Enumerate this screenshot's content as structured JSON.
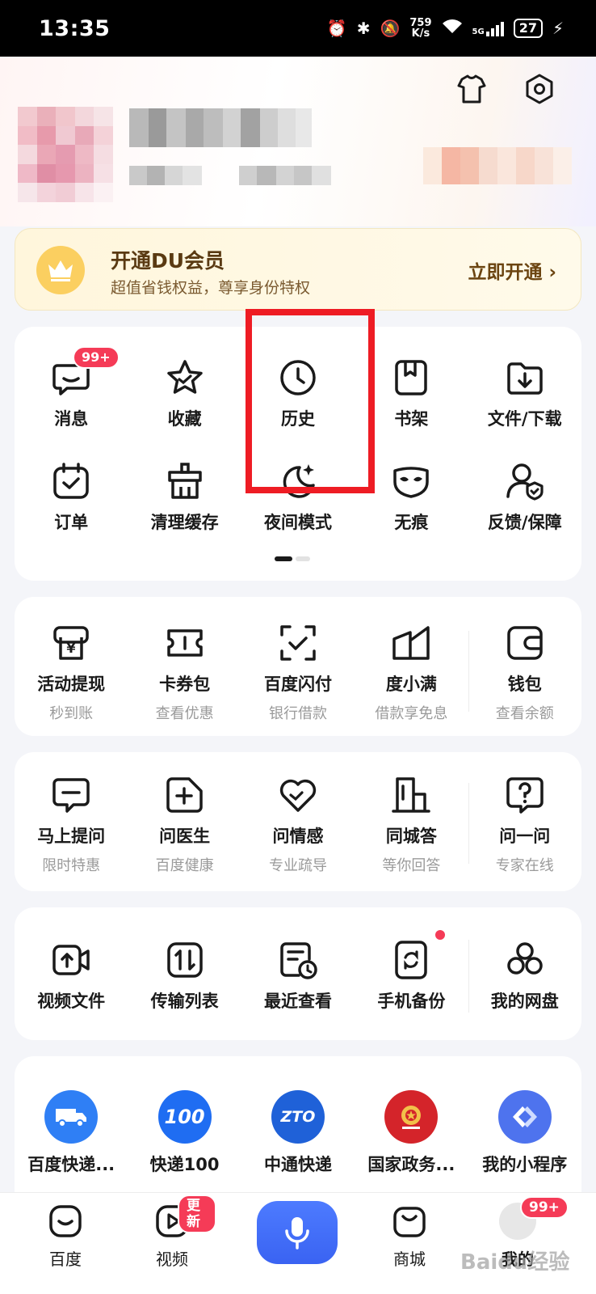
{
  "status_bar": {
    "time": "13:35",
    "speed_value": "759",
    "speed_unit": "K/s",
    "network": "5G",
    "battery": "27"
  },
  "vip": {
    "title": "开通DU会员",
    "subtitle": "超值省钱权益，尊享身份特权",
    "cta": "立即开通 ›"
  },
  "tools": [
    {
      "label": "消息",
      "icon": "message-icon",
      "badge": "99+"
    },
    {
      "label": "收藏",
      "icon": "star-icon"
    },
    {
      "label": "历史",
      "icon": "clock-icon"
    },
    {
      "label": "书架",
      "icon": "bookshelf-icon"
    },
    {
      "label": "文件/下载",
      "icon": "download-folder-icon"
    },
    {
      "label": "订单",
      "icon": "order-icon"
    },
    {
      "label": "清理缓存",
      "icon": "clean-icon"
    },
    {
      "label": "夜间模式",
      "icon": "moon-icon"
    },
    {
      "label": "无痕",
      "icon": "mask-icon"
    },
    {
      "label": "反馈/保障",
      "icon": "feedback-icon"
    }
  ],
  "finance": [
    {
      "label": "活动提现",
      "sub": "秒到账",
      "icon": "cash-icon"
    },
    {
      "label": "卡券包",
      "sub": "查看优惠",
      "icon": "ticket-icon"
    },
    {
      "label": "百度闪付",
      "sub": "银行借款",
      "icon": "scan-pay-icon"
    },
    {
      "label": "度小满",
      "sub": "借款享免息",
      "icon": "duxiaoman-icon"
    },
    {
      "label": "钱包",
      "sub": "查看余额",
      "icon": "wallet-icon"
    }
  ],
  "consult": [
    {
      "label": "马上提问",
      "sub": "限时特惠",
      "icon": "question-bubble-icon"
    },
    {
      "label": "问医生",
      "sub": "百度健康",
      "icon": "doctor-icon"
    },
    {
      "label": "问情感",
      "sub": "专业疏导",
      "icon": "heart-icon"
    },
    {
      "label": "同城答",
      "sub": "等你回答",
      "icon": "building-icon"
    },
    {
      "label": "问一问",
      "sub": "专家在线",
      "icon": "ask-icon"
    }
  ],
  "cloud": [
    {
      "label": "视频文件",
      "icon": "video-file-icon"
    },
    {
      "label": "传输列表",
      "icon": "transfer-icon"
    },
    {
      "label": "最近查看",
      "icon": "recent-icon"
    },
    {
      "label": "手机备份",
      "icon": "backup-icon",
      "dot": true
    },
    {
      "label": "我的网盘",
      "icon": "netdisk-icon"
    }
  ],
  "apps": [
    {
      "label": "百度快递...",
      "icon": "baidu-express-icon",
      "color": "#2f7ff5"
    },
    {
      "label": "快递100",
      "icon": "kuaidi100-icon",
      "color": "#1f6df2",
      "text": "100"
    },
    {
      "label": "中通快递",
      "icon": "zto-icon",
      "color": "#1f61d8",
      "text": "ZTO"
    },
    {
      "label": "国家政务...",
      "icon": "gov-icon",
      "color": "#d4242a"
    },
    {
      "label": "我的小程序",
      "icon": "mini-program-icon",
      "color": "#4e73ee"
    }
  ],
  "nav": {
    "home": "百度",
    "video": "视频",
    "video_badge": "更新",
    "mall": "商城",
    "mine": "我的",
    "mine_badge": "99+"
  },
  "watermark": "Baidu经验"
}
